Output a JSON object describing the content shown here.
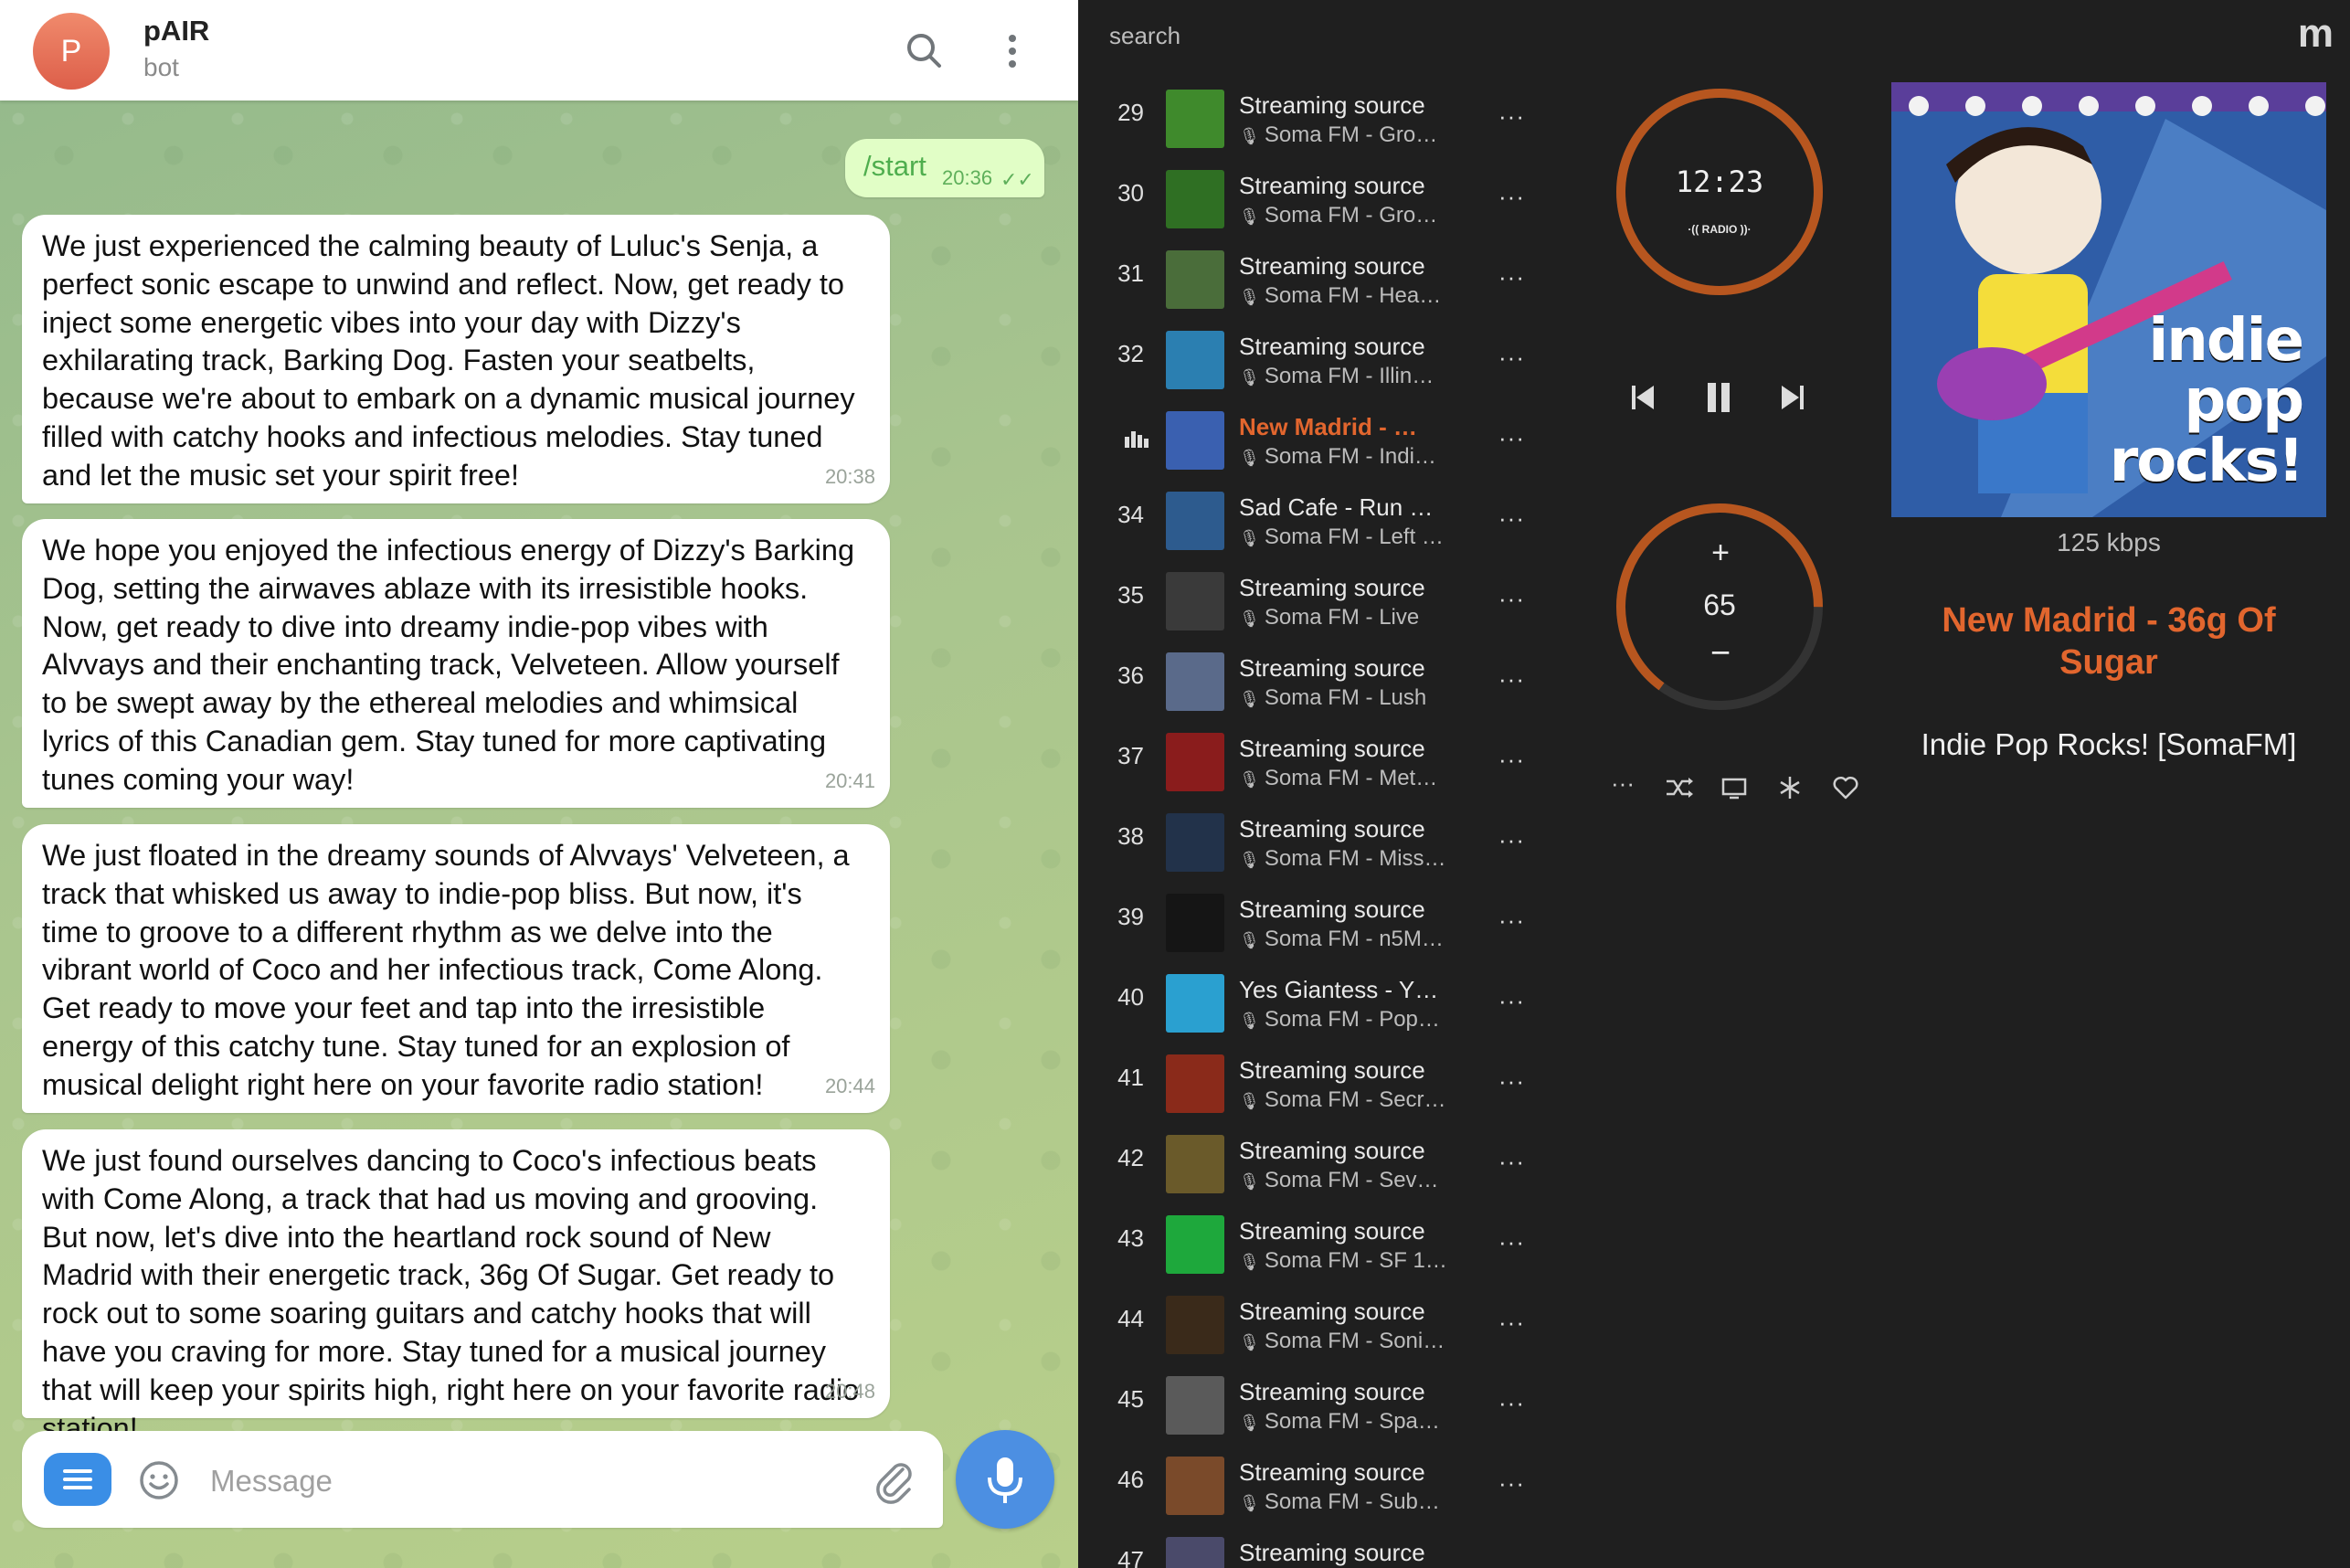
{
  "telegram": {
    "avatar_letter": "P",
    "chat_title": "pAIR",
    "chat_subtitle": "bot",
    "outgoing": {
      "text": "/start",
      "time": "20:36",
      "status_icon": "double-check-icon"
    },
    "messages": [
      {
        "text": "We just experienced the calming beauty of Luluc's Senja, a perfect sonic escape to unwind and reflect. Now, get ready to inject some energetic vibes into your day with Dizzy's exhilarating track, Barking Dog. Fasten your seatbelts, because we're about to embark on a dynamic musical journey filled with catchy hooks and infectious melodies. Stay tuned and let the music set your spirit free!",
        "time": "20:38"
      },
      {
        "text": "We hope you enjoyed the infectious energy of Dizzy's Barking Dog, setting the airwaves ablaze with its irresistible hooks. Now, get ready to dive into dreamy indie-pop vibes with Alvvays and their enchanting track, Velveteen. Allow yourself to be swept away by the ethereal melodies and whimsical lyrics of this Canadian gem. Stay tuned for more captivating tunes coming your way!",
        "time": "20:41"
      },
      {
        "text": "We just floated in the dreamy sounds of Alvvays' Velveteen, a track that whisked us away to indie-pop bliss. But now, it's time to groove to a different rhythm as we delve into the vibrant world of Coco and her infectious track, Come Along. Get ready to move your feet and tap into the irresistible energy of this catchy tune. Stay tuned for an explosion of musical delight right here on your favorite radio station!",
        "time": "20:44"
      },
      {
        "text": "We just found ourselves dancing to Coco's infectious beats with Come Along, a track that had us moving and grooving. But now, let's dive into the heartland rock sound of New Madrid with their energetic track, 36g Of Sugar. Get ready to rock out to some soaring guitars and catchy hooks that will have you craving for more. Stay tuned for a musical journey that will keep your spirits high, right here on your favorite radio station!",
        "time": "20:48"
      }
    ],
    "compose_placeholder": "Message",
    "colors": {
      "accent": "#3a8ee6",
      "outgoing_bubble": "#e1fec6",
      "outgoing_text": "#4fae4e"
    }
  },
  "player": {
    "search_placeholder": "search",
    "logo": "m",
    "clock": {
      "time": "12:23",
      "mode": "RADIO",
      "ring_fraction": 1.0
    },
    "volume": {
      "value": "65",
      "plus": "+",
      "minus": "−",
      "fraction": 0.65
    },
    "accent_color": "#e2662e",
    "album_art_text": [
      "indie",
      "pop",
      "rocks!"
    ],
    "bitrate": "125 kbps",
    "now_playing_track": "New Madrid - 36g Of Sugar",
    "now_playing_station": "Indie Pop Rocks! [SomaFM]",
    "playlist": [
      {
        "num": "29",
        "title": "Streaming source",
        "subtitle": "Soma FM - Gro…",
        "thumb_color": "#3f8a2c"
      },
      {
        "num": "30",
        "title": "Streaming source",
        "subtitle": "Soma FM - Gro…",
        "thumb_color": "#2f6f23"
      },
      {
        "num": "31",
        "title": "Streaming source",
        "subtitle": "Soma FM - Hea…",
        "thumb_color": "#4a6d3a"
      },
      {
        "num": "32",
        "title": "Streaming source",
        "subtitle": "Soma FM - Illin…",
        "thumb_color": "#2b7fb1"
      },
      {
        "num": "",
        "title": "New Madrid - …",
        "subtitle": "Soma FM - Indi…",
        "thumb_color": "#3a60b0",
        "active": true
      },
      {
        "num": "34",
        "title": "Sad Cafe - Run …",
        "subtitle": "Soma FM - Left …",
        "thumb_color": "#2d5b8e"
      },
      {
        "num": "35",
        "title": "Streaming source",
        "subtitle": "Soma FM - Live",
        "thumb_color": "#3a3a3a"
      },
      {
        "num": "36",
        "title": "Streaming source",
        "subtitle": "Soma FM - Lush",
        "thumb_color": "#5a6a8a"
      },
      {
        "num": "37",
        "title": "Streaming source",
        "subtitle": "Soma FM - Met…",
        "thumb_color": "#8a1c1c"
      },
      {
        "num": "38",
        "title": "Streaming source",
        "subtitle": "Soma FM - Miss…",
        "thumb_color": "#22324a"
      },
      {
        "num": "39",
        "title": "Streaming source",
        "subtitle": "Soma FM - n5M…",
        "thumb_color": "#151515"
      },
      {
        "num": "40",
        "title": "Yes Giantess - Y…",
        "subtitle": "Soma FM - Pop…",
        "thumb_color": "#2aa0d0"
      },
      {
        "num": "41",
        "title": "Streaming source",
        "subtitle": "Soma FM - Secr…",
        "thumb_color": "#8a2a1a"
      },
      {
        "num": "42",
        "title": "Streaming source",
        "subtitle": "Soma FM - Sev…",
        "thumb_color": "#6a5a2a"
      },
      {
        "num": "43",
        "title": "Streaming source",
        "subtitle": "Soma FM - SF 1…",
        "thumb_color": "#1ea83c"
      },
      {
        "num": "44",
        "title": "Streaming source",
        "subtitle": "Soma FM - Soni…",
        "thumb_color": "#3a2a1a"
      },
      {
        "num": "45",
        "title": "Streaming source",
        "subtitle": "Soma FM - Spa…",
        "thumb_color": "#5a5a5a"
      },
      {
        "num": "46",
        "title": "Streaming source",
        "subtitle": "Soma FM - Sub…",
        "thumb_color": "#7a4a2a"
      },
      {
        "num": "47",
        "title": "Streaming source",
        "subtitle": "",
        "thumb_color": "#4a4a6a"
      }
    ]
  }
}
